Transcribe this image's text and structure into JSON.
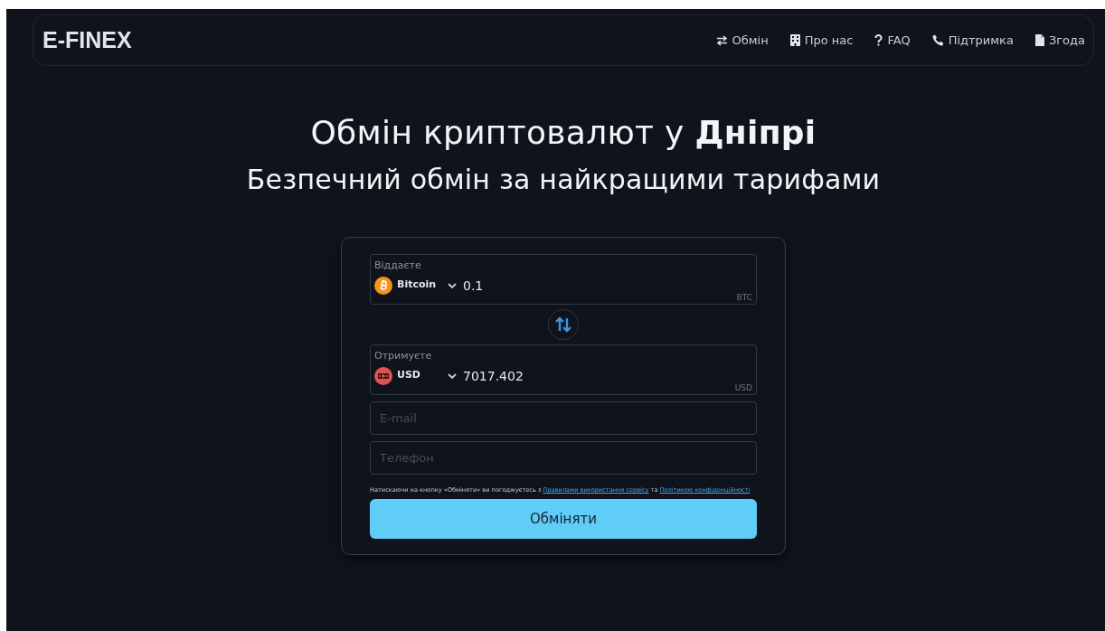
{
  "header": {
    "logo": "E-FINEX",
    "nav": [
      {
        "label": "Обмін"
      },
      {
        "label": "Про нас"
      },
      {
        "label": "FAQ"
      },
      {
        "label": "Підтримка"
      },
      {
        "label": "Згода"
      }
    ]
  },
  "hero": {
    "title": "Обмін криптовалют у **Дніпрі**",
    "subtitle": "Безпечний обмін за найкращими тарифами"
  },
  "exchange": {
    "give": {
      "label": "Віддаєте",
      "kind": "bitcoin",
      "currency": "Bitcoin",
      "amount": "0.1",
      "unit": "BTC"
    },
    "receive": {
      "label": "Отримуєте",
      "kind": "usd",
      "currency": "USD",
      "amount": "7017.402",
      "unit": "USD"
    },
    "email": {
      "placeholder": "E-mail"
    },
    "phone": {
      "placeholder": "Телефон"
    },
    "agreement": {
      "text": "Натискаючи на кнопку «Обміняти» ви погоджуєтесь з",
      "rules_link": "Правилами використання сервісу",
      "joiner": "та",
      "privacy_link": "Політикою конфіденційності"
    },
    "submit": "Обміняти"
  }
}
